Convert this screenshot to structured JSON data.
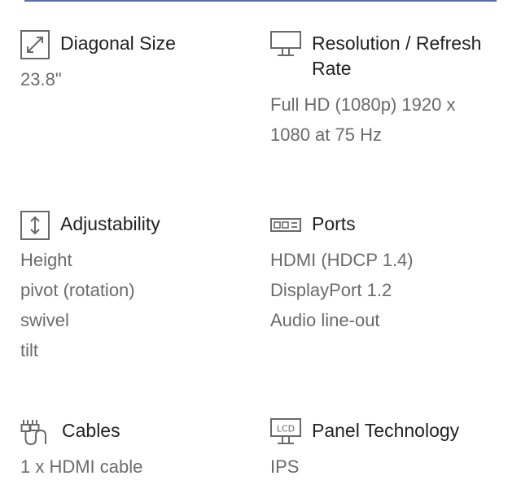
{
  "specs": {
    "diagonal": {
      "icon": "diagonal-resize-icon",
      "title": "Diagonal Size",
      "values": [
        "23.8\""
      ]
    },
    "resolution": {
      "icon": "monitor-icon",
      "title": "Resolution / Refresh Rate",
      "values": [
        "Full HD (1080p) 1920 x 1080 at 75 Hz"
      ]
    },
    "adjustability": {
      "icon": "vertical-arrows-icon",
      "title": "Adjustability",
      "values": [
        "Height",
        "pivot (rotation)",
        "swivel",
        "tilt"
      ]
    },
    "ports": {
      "icon": "ports-icon",
      "title": "Ports",
      "values": [
        "HDMI (HDCP 1.4)",
        "DisplayPort 1.2",
        "Audio line-out"
      ]
    },
    "cables": {
      "icon": "cable-plug-icon",
      "title": "Cables",
      "values": [
        "1 x HDMI cable"
      ]
    },
    "panel": {
      "icon": "lcd-monitor-icon",
      "icon_text": "LCD",
      "title": "Panel Technology",
      "values": [
        "IPS"
      ]
    }
  }
}
